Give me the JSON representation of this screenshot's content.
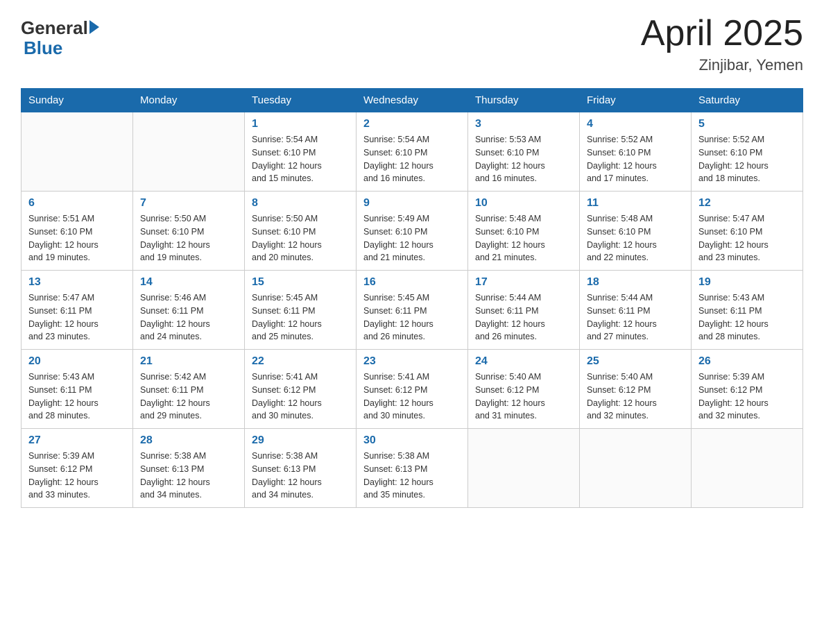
{
  "logo": {
    "general": "General",
    "blue": "Blue"
  },
  "title": "April 2025",
  "subtitle": "Zinjibar, Yemen",
  "days_of_week": [
    "Sunday",
    "Monday",
    "Tuesday",
    "Wednesday",
    "Thursday",
    "Friday",
    "Saturday"
  ],
  "weeks": [
    [
      {
        "day": "",
        "info": ""
      },
      {
        "day": "",
        "info": ""
      },
      {
        "day": "1",
        "info": "Sunrise: 5:54 AM\nSunset: 6:10 PM\nDaylight: 12 hours\nand 15 minutes."
      },
      {
        "day": "2",
        "info": "Sunrise: 5:54 AM\nSunset: 6:10 PM\nDaylight: 12 hours\nand 16 minutes."
      },
      {
        "day": "3",
        "info": "Sunrise: 5:53 AM\nSunset: 6:10 PM\nDaylight: 12 hours\nand 16 minutes."
      },
      {
        "day": "4",
        "info": "Sunrise: 5:52 AM\nSunset: 6:10 PM\nDaylight: 12 hours\nand 17 minutes."
      },
      {
        "day": "5",
        "info": "Sunrise: 5:52 AM\nSunset: 6:10 PM\nDaylight: 12 hours\nand 18 minutes."
      }
    ],
    [
      {
        "day": "6",
        "info": "Sunrise: 5:51 AM\nSunset: 6:10 PM\nDaylight: 12 hours\nand 19 minutes."
      },
      {
        "day": "7",
        "info": "Sunrise: 5:50 AM\nSunset: 6:10 PM\nDaylight: 12 hours\nand 19 minutes."
      },
      {
        "day": "8",
        "info": "Sunrise: 5:50 AM\nSunset: 6:10 PM\nDaylight: 12 hours\nand 20 minutes."
      },
      {
        "day": "9",
        "info": "Sunrise: 5:49 AM\nSunset: 6:10 PM\nDaylight: 12 hours\nand 21 minutes."
      },
      {
        "day": "10",
        "info": "Sunrise: 5:48 AM\nSunset: 6:10 PM\nDaylight: 12 hours\nand 21 minutes."
      },
      {
        "day": "11",
        "info": "Sunrise: 5:48 AM\nSunset: 6:10 PM\nDaylight: 12 hours\nand 22 minutes."
      },
      {
        "day": "12",
        "info": "Sunrise: 5:47 AM\nSunset: 6:10 PM\nDaylight: 12 hours\nand 23 minutes."
      }
    ],
    [
      {
        "day": "13",
        "info": "Sunrise: 5:47 AM\nSunset: 6:11 PM\nDaylight: 12 hours\nand 23 minutes."
      },
      {
        "day": "14",
        "info": "Sunrise: 5:46 AM\nSunset: 6:11 PM\nDaylight: 12 hours\nand 24 minutes."
      },
      {
        "day": "15",
        "info": "Sunrise: 5:45 AM\nSunset: 6:11 PM\nDaylight: 12 hours\nand 25 minutes."
      },
      {
        "day": "16",
        "info": "Sunrise: 5:45 AM\nSunset: 6:11 PM\nDaylight: 12 hours\nand 26 minutes."
      },
      {
        "day": "17",
        "info": "Sunrise: 5:44 AM\nSunset: 6:11 PM\nDaylight: 12 hours\nand 26 minutes."
      },
      {
        "day": "18",
        "info": "Sunrise: 5:44 AM\nSunset: 6:11 PM\nDaylight: 12 hours\nand 27 minutes."
      },
      {
        "day": "19",
        "info": "Sunrise: 5:43 AM\nSunset: 6:11 PM\nDaylight: 12 hours\nand 28 minutes."
      }
    ],
    [
      {
        "day": "20",
        "info": "Sunrise: 5:43 AM\nSunset: 6:11 PM\nDaylight: 12 hours\nand 28 minutes."
      },
      {
        "day": "21",
        "info": "Sunrise: 5:42 AM\nSunset: 6:11 PM\nDaylight: 12 hours\nand 29 minutes."
      },
      {
        "day": "22",
        "info": "Sunrise: 5:41 AM\nSunset: 6:12 PM\nDaylight: 12 hours\nand 30 minutes."
      },
      {
        "day": "23",
        "info": "Sunrise: 5:41 AM\nSunset: 6:12 PM\nDaylight: 12 hours\nand 30 minutes."
      },
      {
        "day": "24",
        "info": "Sunrise: 5:40 AM\nSunset: 6:12 PM\nDaylight: 12 hours\nand 31 minutes."
      },
      {
        "day": "25",
        "info": "Sunrise: 5:40 AM\nSunset: 6:12 PM\nDaylight: 12 hours\nand 32 minutes."
      },
      {
        "day": "26",
        "info": "Sunrise: 5:39 AM\nSunset: 6:12 PM\nDaylight: 12 hours\nand 32 minutes."
      }
    ],
    [
      {
        "day": "27",
        "info": "Sunrise: 5:39 AM\nSunset: 6:12 PM\nDaylight: 12 hours\nand 33 minutes."
      },
      {
        "day": "28",
        "info": "Sunrise: 5:38 AM\nSunset: 6:13 PM\nDaylight: 12 hours\nand 34 minutes."
      },
      {
        "day": "29",
        "info": "Sunrise: 5:38 AM\nSunset: 6:13 PM\nDaylight: 12 hours\nand 34 minutes."
      },
      {
        "day": "30",
        "info": "Sunrise: 5:38 AM\nSunset: 6:13 PM\nDaylight: 12 hours\nand 35 minutes."
      },
      {
        "day": "",
        "info": ""
      },
      {
        "day": "",
        "info": ""
      },
      {
        "day": "",
        "info": ""
      }
    ]
  ]
}
